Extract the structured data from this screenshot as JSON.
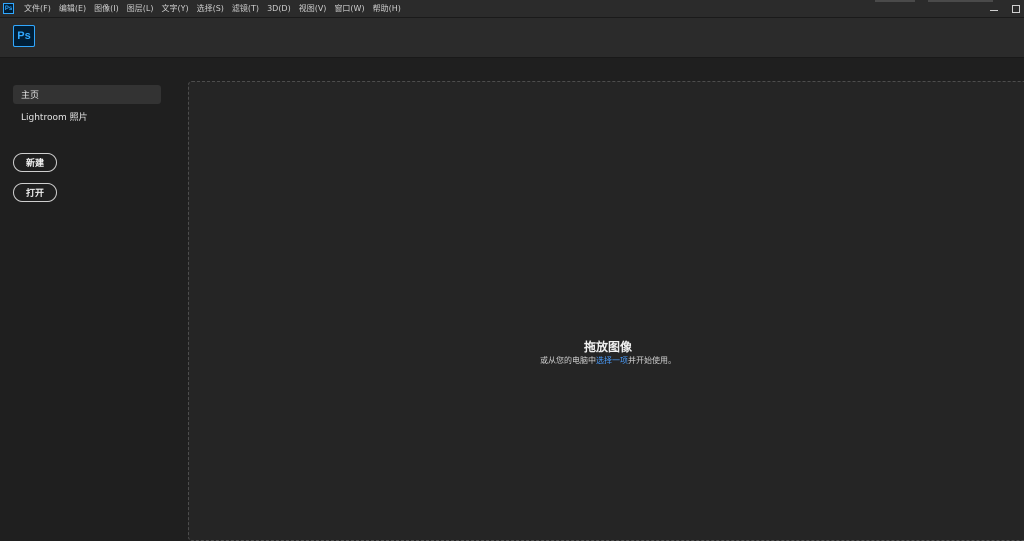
{
  "menubar": {
    "app_icon": "Ps",
    "items": [
      {
        "label": "文件(F)"
      },
      {
        "label": "编辑(E)"
      },
      {
        "label": "图像(I)"
      },
      {
        "label": "图层(L)"
      },
      {
        "label": "文字(Y)"
      },
      {
        "label": "选择(S)"
      },
      {
        "label": "滤镜(T)"
      },
      {
        "label": "3D(D)"
      },
      {
        "label": "视图(V)"
      },
      {
        "label": "窗口(W)"
      },
      {
        "label": "帮助(H)"
      }
    ]
  },
  "header": {
    "logo_text": "Ps"
  },
  "sidebar": {
    "nav": [
      {
        "label": "主页",
        "active": true
      },
      {
        "label": "Lightroom 照片",
        "active": false
      }
    ],
    "new_button": "新建",
    "open_button": "打开"
  },
  "dropzone": {
    "title": "拖放图像",
    "sub_prefix": "或从您的电脑中",
    "sub_link": "选择一项",
    "sub_suffix": "并开始使用。"
  },
  "colors": {
    "accent": "#31a8ff",
    "link": "#4a9eff",
    "background": "#1f1f1f",
    "panel": "#252525"
  }
}
